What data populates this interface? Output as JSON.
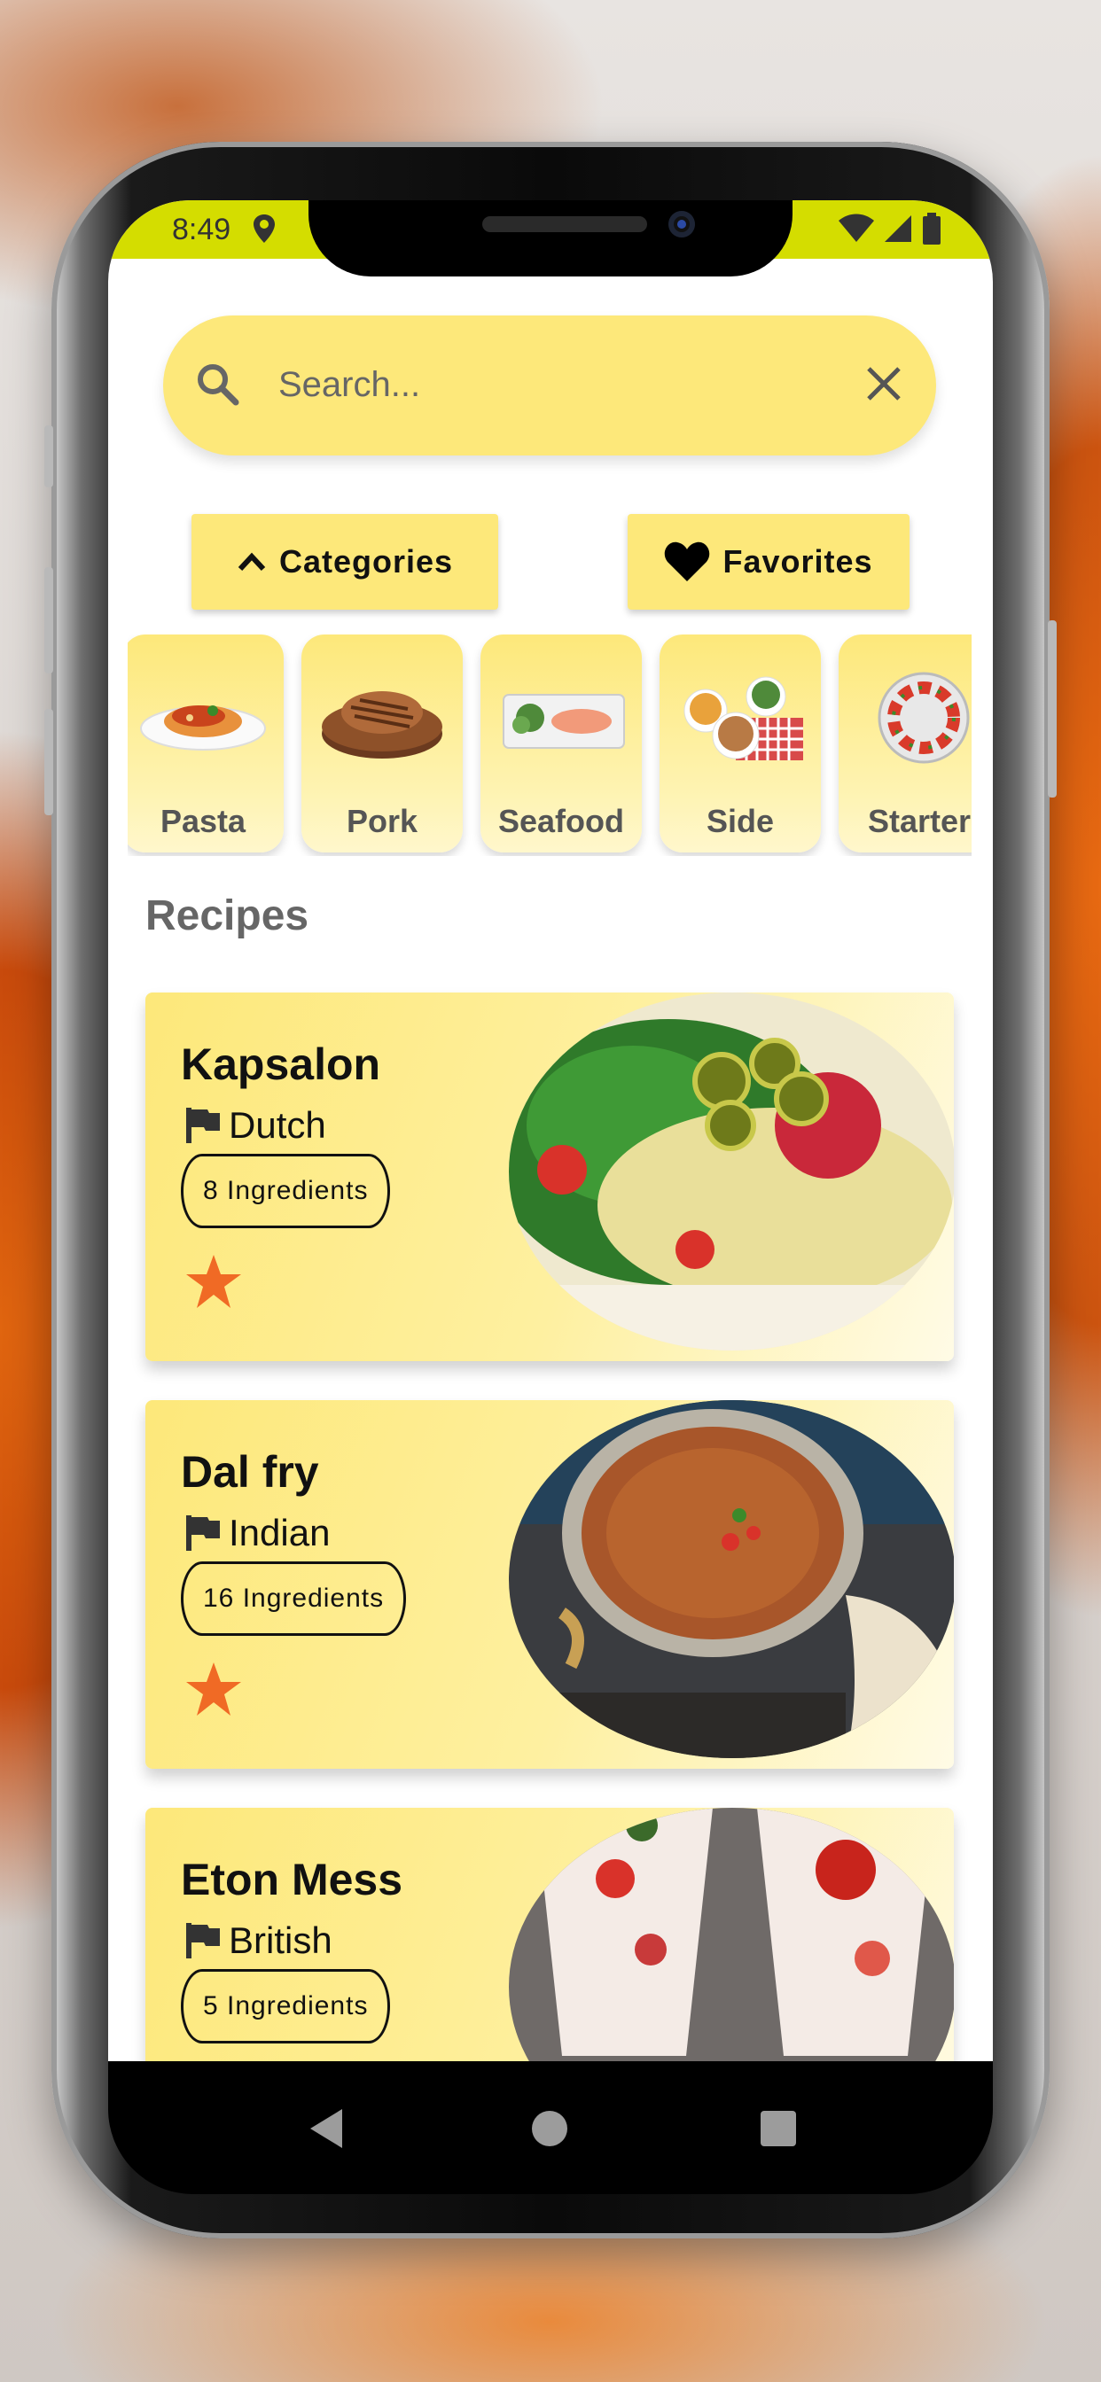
{
  "status_bar": {
    "time": "8:49",
    "bg_color": "#d4dd00"
  },
  "search": {
    "placeholder": "Search...",
    "icons": [
      "search-icon",
      "close-icon"
    ]
  },
  "buttons": {
    "categories_label": "Categories",
    "favorites_label": "Favorites"
  },
  "categories": [
    {
      "label": "Pasta",
      "image": "pasta-dish"
    },
    {
      "label": "Pork",
      "image": "pork-steak"
    },
    {
      "label": "Seafood",
      "image": "salmon-platter"
    },
    {
      "label": "Side",
      "image": "side-dishes"
    },
    {
      "label": "Starter",
      "image": "caprese-plate"
    }
  ],
  "section": {
    "title": "Recipes"
  },
  "recipes": [
    {
      "name": "Kapsalon",
      "area": "Dutch",
      "ingredients": "8 Ingredients",
      "favorite": true,
      "image": "kapsalon-photo"
    },
    {
      "name": "Dal fry",
      "area": "Indian",
      "ingredients": "16 Ingredients",
      "favorite": true,
      "image": "dal-fry-photo"
    },
    {
      "name": "Eton Mess",
      "area": "British",
      "ingredients": "5 Ingredients",
      "favorite": false,
      "image": "eton-mess-photo"
    }
  ],
  "colors": {
    "accent": "#fde87a",
    "star": "#f06a25",
    "text": "#111111",
    "muted": "#666666"
  }
}
